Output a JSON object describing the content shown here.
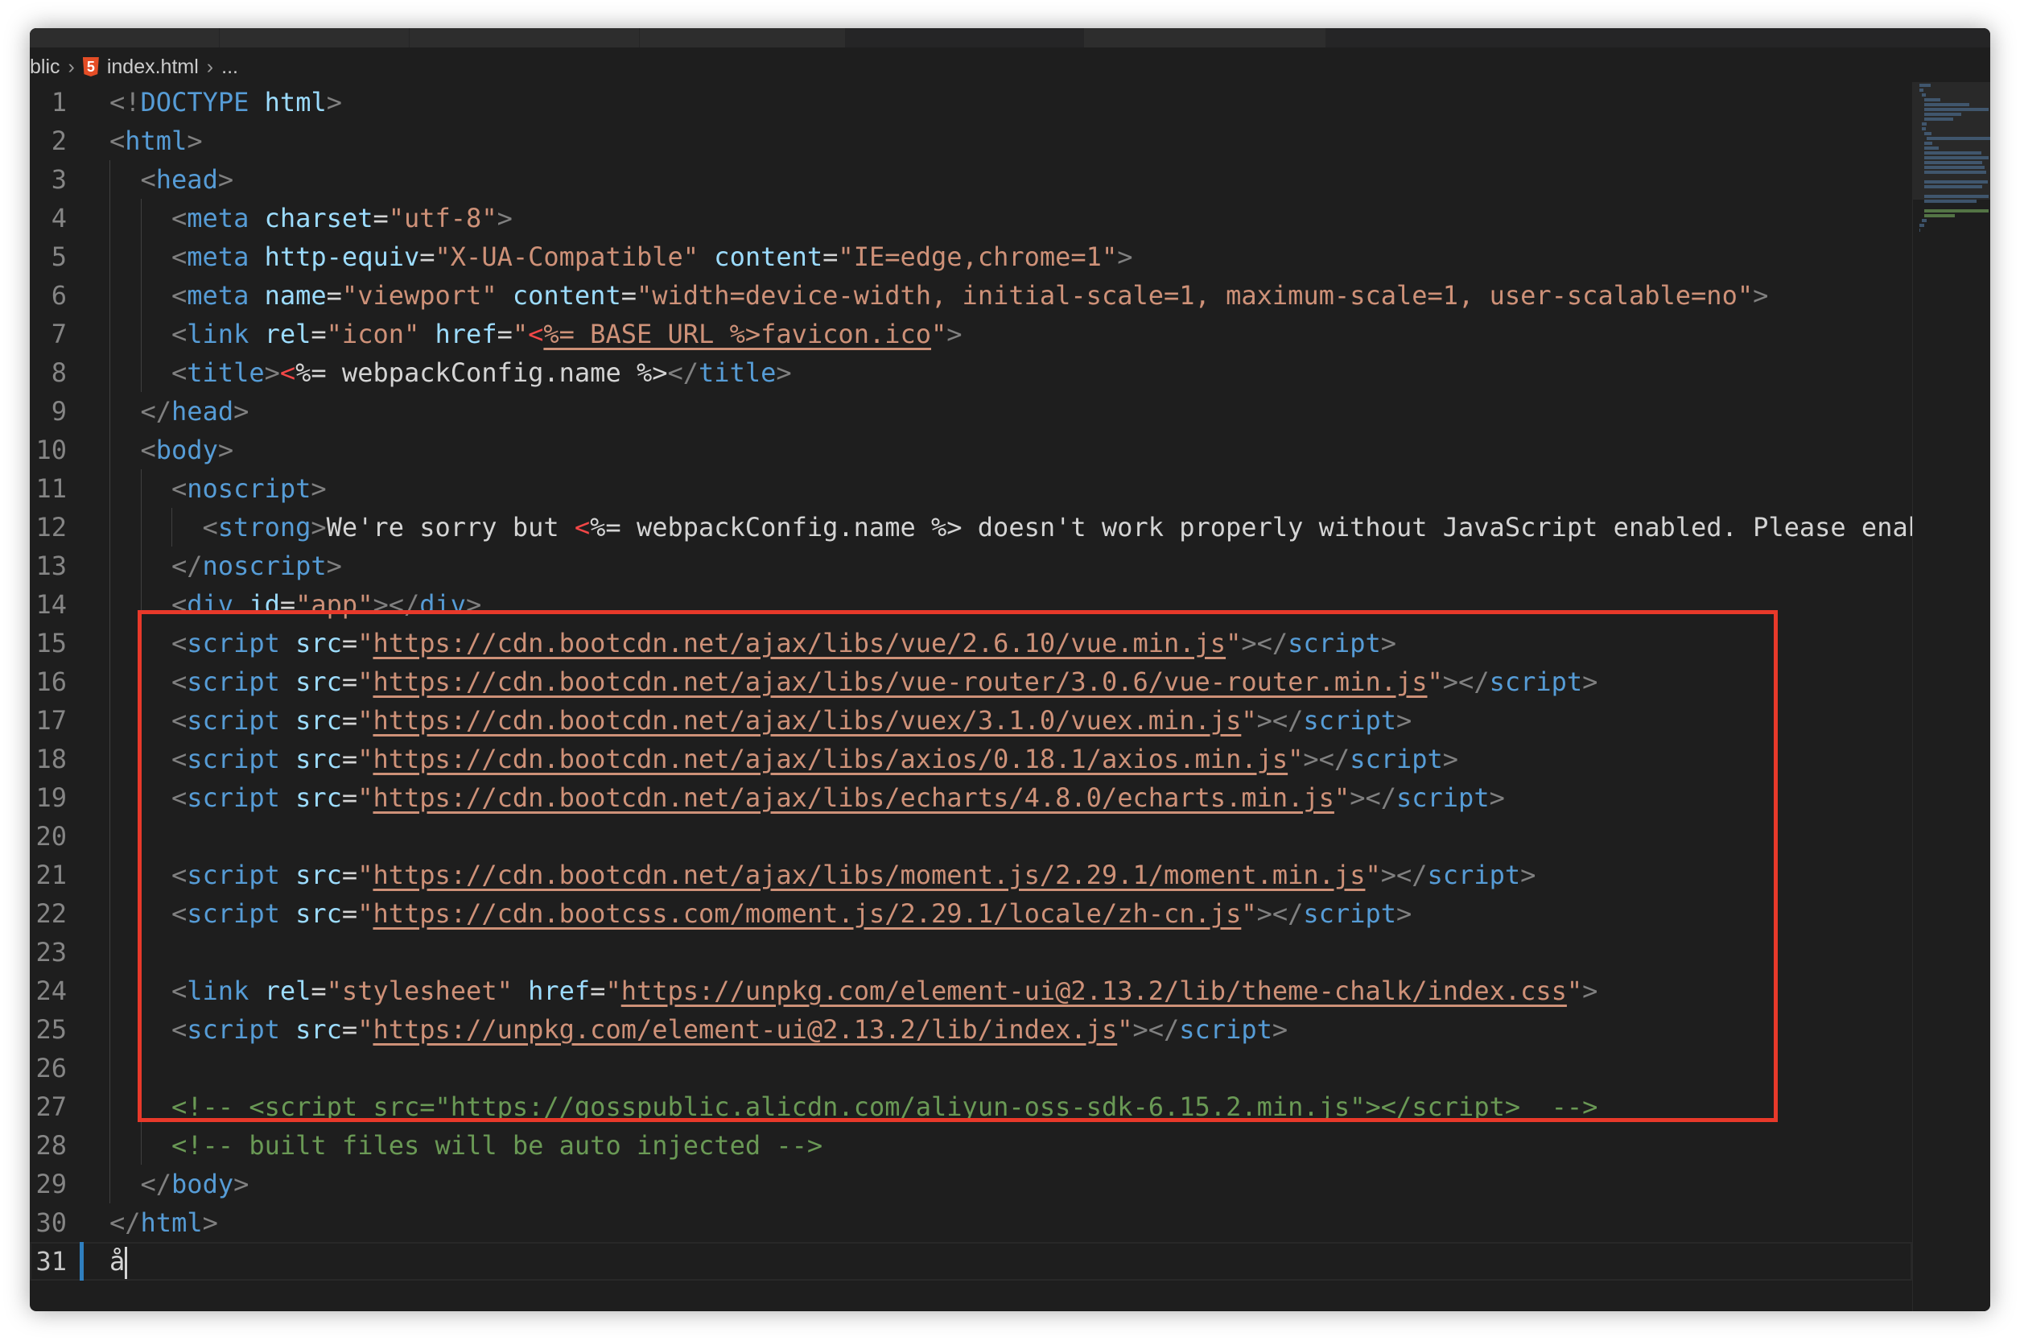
{
  "breadcrumb": {
    "items": [
      "blic",
      "index.html",
      "..."
    ]
  },
  "colors": {
    "tag": "#569cd6",
    "attr": "#9cdcfe",
    "string": "#ce9178",
    "comment": "#6a9955",
    "punct": "#808080",
    "highlight_box": "#e8392a"
  },
  "editor": {
    "current_line": 31,
    "lines": [
      {
        "n": "1",
        "indent": 0,
        "tokens": [
          {
            "k": "p",
            "v": "<!"
          },
          {
            "k": "t",
            "v": "DOCTYPE"
          },
          {
            "k": "x",
            "v": " "
          },
          {
            "k": "a",
            "v": "html"
          },
          {
            "k": "p",
            "v": ">"
          }
        ]
      },
      {
        "n": "2",
        "indent": 0,
        "tokens": [
          {
            "k": "p",
            "v": "<"
          },
          {
            "k": "t",
            "v": "html"
          },
          {
            "k": "p",
            "v": ">"
          }
        ]
      },
      {
        "n": "3",
        "indent": 1,
        "tokens": [
          {
            "k": "p",
            "v": "<"
          },
          {
            "k": "t",
            "v": "head"
          },
          {
            "k": "p",
            "v": ">"
          }
        ]
      },
      {
        "n": "4",
        "indent": 2,
        "tokens": [
          {
            "k": "p",
            "v": "<"
          },
          {
            "k": "t",
            "v": "meta"
          },
          {
            "k": "x",
            "v": " "
          },
          {
            "k": "a",
            "v": "charset"
          },
          {
            "k": "x",
            "v": "="
          },
          {
            "k": "s",
            "v": "\"utf-8\""
          },
          {
            "k": "p",
            "v": ">"
          }
        ]
      },
      {
        "n": "5",
        "indent": 2,
        "tokens": [
          {
            "k": "p",
            "v": "<"
          },
          {
            "k": "t",
            "v": "meta"
          },
          {
            "k": "x",
            "v": " "
          },
          {
            "k": "a",
            "v": "http-equiv"
          },
          {
            "k": "x",
            "v": "="
          },
          {
            "k": "s",
            "v": "\"X-UA-Compatible\""
          },
          {
            "k": "x",
            "v": " "
          },
          {
            "k": "a",
            "v": "content"
          },
          {
            "k": "x",
            "v": "="
          },
          {
            "k": "s",
            "v": "\"IE=edge,chrome=1\""
          },
          {
            "k": "p",
            "v": ">"
          }
        ]
      },
      {
        "n": "6",
        "indent": 2,
        "tokens": [
          {
            "k": "p",
            "v": "<"
          },
          {
            "k": "t",
            "v": "meta"
          },
          {
            "k": "x",
            "v": " "
          },
          {
            "k": "a",
            "v": "name"
          },
          {
            "k": "x",
            "v": "="
          },
          {
            "k": "s",
            "v": "\"viewport\""
          },
          {
            "k": "x",
            "v": " "
          },
          {
            "k": "a",
            "v": "content"
          },
          {
            "k": "x",
            "v": "="
          },
          {
            "k": "s",
            "v": "\"width=device-width, initial-scale=1, maximum-scale=1, user-scalable=no\""
          },
          {
            "k": "p",
            "v": ">"
          }
        ]
      },
      {
        "n": "7",
        "indent": 2,
        "tokens": [
          {
            "k": "p",
            "v": "<"
          },
          {
            "k": "t",
            "v": "link"
          },
          {
            "k": "x",
            "v": " "
          },
          {
            "k": "a",
            "v": "rel"
          },
          {
            "k": "x",
            "v": "="
          },
          {
            "k": "s",
            "v": "\"icon\""
          },
          {
            "k": "x",
            "v": " "
          },
          {
            "k": "a",
            "v": "href"
          },
          {
            "k": "x",
            "v": "="
          },
          {
            "k": "s",
            "v": "\""
          },
          {
            "k": "r",
            "v": "<"
          },
          {
            "k": "u",
            "v": "%= BASE_URL %>favicon.ico"
          },
          {
            "k": "s",
            "v": "\""
          },
          {
            "k": "p",
            "v": ">"
          }
        ]
      },
      {
        "n": "8",
        "indent": 2,
        "tokens": [
          {
            "k": "p",
            "v": "<"
          },
          {
            "k": "t",
            "v": "title"
          },
          {
            "k": "p",
            "v": ">"
          },
          {
            "k": "r",
            "v": "<"
          },
          {
            "k": "x",
            "v": "%= webpackConfig.name %>"
          },
          {
            "k": "p",
            "v": "</"
          },
          {
            "k": "t",
            "v": "title"
          },
          {
            "k": "p",
            "v": ">"
          }
        ]
      },
      {
        "n": "9",
        "indent": 1,
        "tokens": [
          {
            "k": "p",
            "v": "</"
          },
          {
            "k": "t",
            "v": "head"
          },
          {
            "k": "p",
            "v": ">"
          }
        ]
      },
      {
        "n": "10",
        "indent": 1,
        "tokens": [
          {
            "k": "p",
            "v": "<"
          },
          {
            "k": "t",
            "v": "body"
          },
          {
            "k": "p",
            "v": ">"
          }
        ]
      },
      {
        "n": "11",
        "indent": 2,
        "tokens": [
          {
            "k": "p",
            "v": "<"
          },
          {
            "k": "t",
            "v": "noscript"
          },
          {
            "k": "p",
            "v": ">"
          }
        ]
      },
      {
        "n": "12",
        "indent": 3,
        "tokens": [
          {
            "k": "p",
            "v": "<"
          },
          {
            "k": "t",
            "v": "strong"
          },
          {
            "k": "p",
            "v": ">"
          },
          {
            "k": "x",
            "v": "We're sorry but "
          },
          {
            "k": "r",
            "v": "<"
          },
          {
            "k": "x",
            "v": "%= webpackConfig.name %> doesn't work properly without JavaScript enabled. Please enab"
          }
        ]
      },
      {
        "n": "13",
        "indent": 2,
        "tokens": [
          {
            "k": "p",
            "v": "</"
          },
          {
            "k": "t",
            "v": "noscript"
          },
          {
            "k": "p",
            "v": ">"
          }
        ]
      },
      {
        "n": "14",
        "indent": 2,
        "tokens": [
          {
            "k": "p",
            "v": "<"
          },
          {
            "k": "t",
            "v": "div"
          },
          {
            "k": "x",
            "v": " "
          },
          {
            "k": "a",
            "v": "id"
          },
          {
            "k": "x",
            "v": "="
          },
          {
            "k": "s",
            "v": "\"app\""
          },
          {
            "k": "p",
            "v": "></"
          },
          {
            "k": "t",
            "v": "div"
          },
          {
            "k": "p",
            "v": ">"
          }
        ]
      },
      {
        "n": "15",
        "indent": 2,
        "tokens": [
          {
            "k": "p",
            "v": "<"
          },
          {
            "k": "t",
            "v": "script"
          },
          {
            "k": "x",
            "v": " "
          },
          {
            "k": "a",
            "v": "src"
          },
          {
            "k": "x",
            "v": "="
          },
          {
            "k": "s",
            "v": "\""
          },
          {
            "k": "u",
            "v": "https://cdn.bootcdn.net/ajax/libs/vue/2.6.10/vue.min.js"
          },
          {
            "k": "s",
            "v": "\""
          },
          {
            "k": "p",
            "v": "></"
          },
          {
            "k": "t",
            "v": "script"
          },
          {
            "k": "p",
            "v": ">"
          }
        ]
      },
      {
        "n": "16",
        "indent": 2,
        "tokens": [
          {
            "k": "p",
            "v": "<"
          },
          {
            "k": "t",
            "v": "script"
          },
          {
            "k": "x",
            "v": " "
          },
          {
            "k": "a",
            "v": "src"
          },
          {
            "k": "x",
            "v": "="
          },
          {
            "k": "s",
            "v": "\""
          },
          {
            "k": "u",
            "v": "https://cdn.bootcdn.net/ajax/libs/vue-router/3.0.6/vue-router.min.js"
          },
          {
            "k": "s",
            "v": "\""
          },
          {
            "k": "p",
            "v": "></"
          },
          {
            "k": "t",
            "v": "script"
          },
          {
            "k": "p",
            "v": ">"
          }
        ]
      },
      {
        "n": "17",
        "indent": 2,
        "tokens": [
          {
            "k": "p",
            "v": "<"
          },
          {
            "k": "t",
            "v": "script"
          },
          {
            "k": "x",
            "v": " "
          },
          {
            "k": "a",
            "v": "src"
          },
          {
            "k": "x",
            "v": "="
          },
          {
            "k": "s",
            "v": "\""
          },
          {
            "k": "u",
            "v": "https://cdn.bootcdn.net/ajax/libs/vuex/3.1.0/vuex.min.js"
          },
          {
            "k": "s",
            "v": "\""
          },
          {
            "k": "p",
            "v": "></"
          },
          {
            "k": "t",
            "v": "script"
          },
          {
            "k": "p",
            "v": ">"
          }
        ]
      },
      {
        "n": "18",
        "indent": 2,
        "tokens": [
          {
            "k": "p",
            "v": "<"
          },
          {
            "k": "t",
            "v": "script"
          },
          {
            "k": "x",
            "v": " "
          },
          {
            "k": "a",
            "v": "src"
          },
          {
            "k": "x",
            "v": "="
          },
          {
            "k": "s",
            "v": "\""
          },
          {
            "k": "u",
            "v": "https://cdn.bootcdn.net/ajax/libs/axios/0.18.1/axios.min.js"
          },
          {
            "k": "s",
            "v": "\""
          },
          {
            "k": "p",
            "v": "></"
          },
          {
            "k": "t",
            "v": "script"
          },
          {
            "k": "p",
            "v": ">"
          }
        ]
      },
      {
        "n": "19",
        "indent": 2,
        "tokens": [
          {
            "k": "p",
            "v": "<"
          },
          {
            "k": "t",
            "v": "script"
          },
          {
            "k": "x",
            "v": " "
          },
          {
            "k": "a",
            "v": "src"
          },
          {
            "k": "x",
            "v": "="
          },
          {
            "k": "s",
            "v": "\""
          },
          {
            "k": "u",
            "v": "https://cdn.bootcdn.net/ajax/libs/echarts/4.8.0/echarts.min.js"
          },
          {
            "k": "s",
            "v": "\""
          },
          {
            "k": "p",
            "v": "></"
          },
          {
            "k": "t",
            "v": "script"
          },
          {
            "k": "p",
            "v": ">"
          }
        ]
      },
      {
        "n": "20",
        "indent": 2,
        "tokens": []
      },
      {
        "n": "21",
        "indent": 2,
        "tokens": [
          {
            "k": "p",
            "v": "<"
          },
          {
            "k": "t",
            "v": "script"
          },
          {
            "k": "x",
            "v": " "
          },
          {
            "k": "a",
            "v": "src"
          },
          {
            "k": "x",
            "v": "="
          },
          {
            "k": "s",
            "v": "\""
          },
          {
            "k": "u",
            "v": "https://cdn.bootcdn.net/ajax/libs/moment.js/2.29.1/moment.min.js"
          },
          {
            "k": "s",
            "v": "\""
          },
          {
            "k": "p",
            "v": "></"
          },
          {
            "k": "t",
            "v": "script"
          },
          {
            "k": "p",
            "v": ">"
          }
        ]
      },
      {
        "n": "22",
        "indent": 2,
        "tokens": [
          {
            "k": "p",
            "v": "<"
          },
          {
            "k": "t",
            "v": "script"
          },
          {
            "k": "x",
            "v": " "
          },
          {
            "k": "a",
            "v": "src"
          },
          {
            "k": "x",
            "v": "="
          },
          {
            "k": "s",
            "v": "\""
          },
          {
            "k": "u",
            "v": "https://cdn.bootcss.com/moment.js/2.29.1/locale/zh-cn.js"
          },
          {
            "k": "s",
            "v": "\""
          },
          {
            "k": "p",
            "v": "></"
          },
          {
            "k": "t",
            "v": "script"
          },
          {
            "k": "p",
            "v": ">"
          }
        ]
      },
      {
        "n": "23",
        "indent": 2,
        "tokens": []
      },
      {
        "n": "24",
        "indent": 2,
        "tokens": [
          {
            "k": "p",
            "v": "<"
          },
          {
            "k": "t",
            "v": "link"
          },
          {
            "k": "x",
            "v": " "
          },
          {
            "k": "a",
            "v": "rel"
          },
          {
            "k": "x",
            "v": "="
          },
          {
            "k": "s",
            "v": "\"stylesheet\""
          },
          {
            "k": "x",
            "v": " "
          },
          {
            "k": "a",
            "v": "href"
          },
          {
            "k": "x",
            "v": "="
          },
          {
            "k": "s",
            "v": "\""
          },
          {
            "k": "u",
            "v": "https://unpkg.com/element-ui@2.13.2/lib/theme-chalk/index.css"
          },
          {
            "k": "s",
            "v": "\""
          },
          {
            "k": "p",
            "v": ">"
          }
        ]
      },
      {
        "n": "25",
        "indent": 2,
        "tokens": [
          {
            "k": "p",
            "v": "<"
          },
          {
            "k": "t",
            "v": "script"
          },
          {
            "k": "x",
            "v": " "
          },
          {
            "k": "a",
            "v": "src"
          },
          {
            "k": "x",
            "v": "="
          },
          {
            "k": "s",
            "v": "\""
          },
          {
            "k": "u",
            "v": "https://unpkg.com/element-ui@2.13.2/lib/index.js"
          },
          {
            "k": "s",
            "v": "\""
          },
          {
            "k": "p",
            "v": "></"
          },
          {
            "k": "t",
            "v": "script"
          },
          {
            "k": "p",
            "v": ">"
          }
        ]
      },
      {
        "n": "26",
        "indent": 2,
        "tokens": []
      },
      {
        "n": "27",
        "indent": 2,
        "tokens": [
          {
            "k": "c",
            "v": "<!-- <script src=\"https://gosspublic.alicdn.com/aliyun-oss-sdk-6.15.2.min.js\"></script>  -->"
          }
        ]
      },
      {
        "n": "28",
        "indent": 2,
        "tokens": [
          {
            "k": "c",
            "v": "<!-- built files will be auto injected -->"
          }
        ]
      },
      {
        "n": "29",
        "indent": 1,
        "tokens": [
          {
            "k": "p",
            "v": "</"
          },
          {
            "k": "t",
            "v": "body"
          },
          {
            "k": "p",
            "v": ">"
          }
        ]
      },
      {
        "n": "30",
        "indent": 0,
        "tokens": [
          {
            "k": "p",
            "v": "</"
          },
          {
            "k": "t",
            "v": "html"
          },
          {
            "k": "p",
            "v": ">"
          }
        ]
      },
      {
        "n": "31",
        "indent": 0,
        "tokens": [
          {
            "k": "x",
            "v": "å"
          }
        ]
      }
    ]
  }
}
